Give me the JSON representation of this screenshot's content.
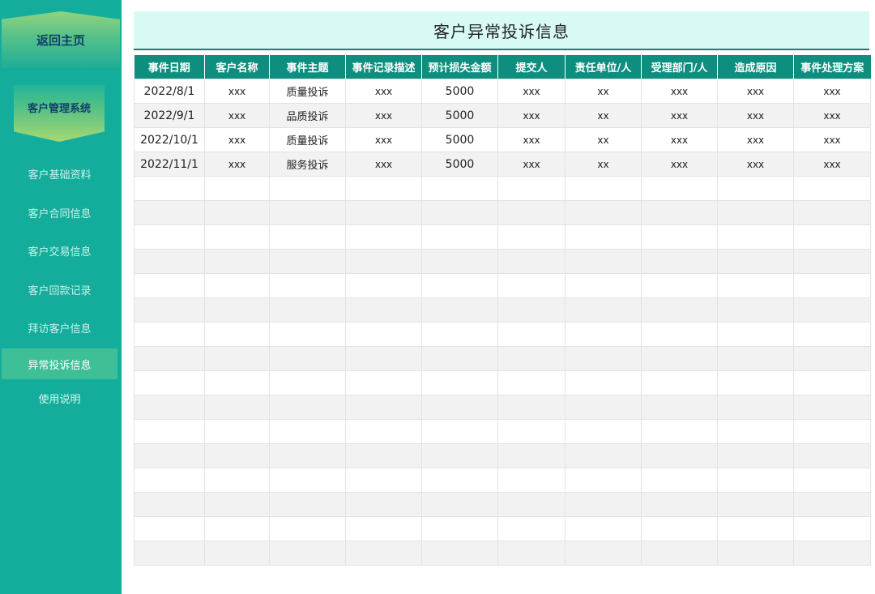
{
  "sidebar": {
    "home_label": "返回主页",
    "system_label": "客户管理系统",
    "items": [
      {
        "label": "客户基础资料"
      },
      {
        "label": "客户合同信息"
      },
      {
        "label": "客户交易信息"
      },
      {
        "label": "客户回款记录"
      },
      {
        "label": "拜访客户信息"
      },
      {
        "label": "异常投诉信息"
      },
      {
        "label": "使用说明"
      }
    ],
    "active_item": "异常投诉信息",
    "colors": {
      "background": "#14ad9c",
      "active": "#3fbf98",
      "header": "#0e8e7e"
    }
  },
  "page": {
    "title": "客户异常投诉信息"
  },
  "table": {
    "columns": [
      "事件日期",
      "客户名称",
      "事件主题",
      "事件记录描述",
      "预计损失金额",
      "提交人",
      "责任单位/人",
      "受理部门/人",
      "造成原因",
      "事件处理方案"
    ],
    "rows": [
      [
        "2022/8/1",
        "xxx",
        "质量投诉",
        "xxx",
        "5000",
        "xxx",
        "xx",
        "xxx",
        "xxx",
        "xxx"
      ],
      [
        "2022/9/1",
        "xxx",
        "品质投诉",
        "xxx",
        "5000",
        "xxx",
        "xx",
        "xxx",
        "xxx",
        "xxx"
      ],
      [
        "2022/10/1",
        "xxx",
        "质量投诉",
        "xxx",
        "5000",
        "xxx",
        "xx",
        "xxx",
        "xxx",
        "xxx"
      ],
      [
        "2022/11/1",
        "xxx",
        "服务投诉",
        "xxx",
        "5000",
        "xxx",
        "xx",
        "xxx",
        "xxx",
        "xxx"
      ]
    ]
  }
}
